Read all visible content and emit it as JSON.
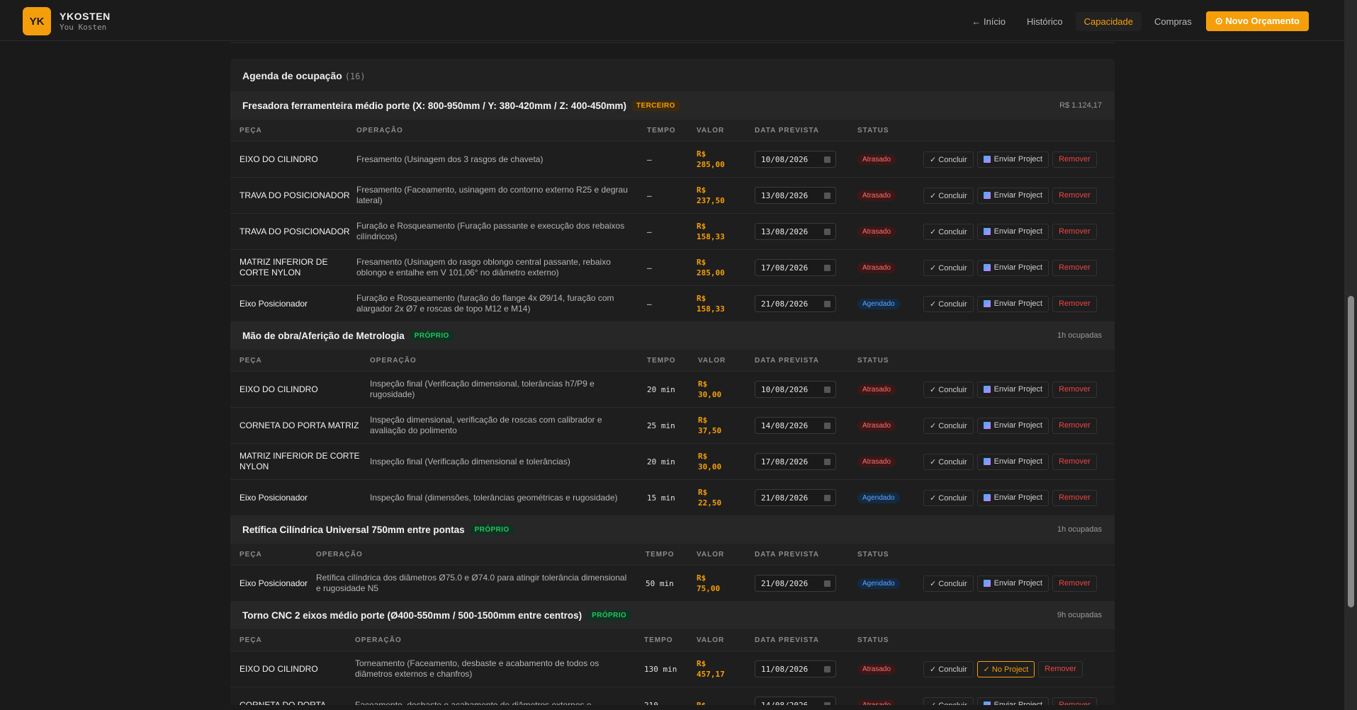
{
  "app": {
    "logo": "YK",
    "name": "YKOSTEN",
    "subtitle": "You Kosten"
  },
  "nav": {
    "items": [
      {
        "label": "← Início",
        "active": false
      },
      {
        "label": "Histórico",
        "active": false
      },
      {
        "label": "Capacidade",
        "active": true
      },
      {
        "label": "Compras",
        "active": false
      }
    ],
    "primary_button": "⊙ Novo Orçamento"
  },
  "colors": {
    "accent": "#f59e0b",
    "late": "#f87171",
    "scheduled": "#60a5fa",
    "proprio": "#22c55e"
  },
  "agenda": {
    "title": "Agenda de ocupação",
    "count": "(16)",
    "columns": {
      "peca": "PEÇA",
      "operacao": "OPERAÇÃO",
      "tempo": "TEMPO",
      "valor": "VALOR",
      "data": "DATA PREVISTA",
      "status": "STATUS"
    },
    "actions": {
      "concluir": "✓ Concluir",
      "enviar": "Enviar Project",
      "remover": "Remover",
      "no_project": "✓ No Project"
    },
    "groups": [
      {
        "name": "Fresadora ferramenteira médio porte (X: 800-950mm / Y: 380-420mm / Z: 400-450mm)",
        "type": "TERCEIRO",
        "right": "R$ 1.124,17",
        "rows": [
          {
            "peca": "EIXO DO CILINDRO",
            "operacao": "Fresamento (Usinagem dos 3 rasgos de chaveta)",
            "tempo": "—",
            "valor": "R$ 285,00",
            "data": "10/08/2026",
            "status": "Atrasado"
          },
          {
            "peca": "TRAVA DO POSICIONADOR",
            "operacao": "Fresamento (Faceamento, usinagem do contorno externo R25 e degrau lateral)",
            "tempo": "—",
            "valor": "R$ 237,50",
            "data": "13/08/2026",
            "status": "Atrasado"
          },
          {
            "peca": "TRAVA DO POSICIONADOR",
            "operacao": "Furação e Rosqueamento (Furação passante e execução dos rebaixos cilíndricos)",
            "tempo": "—",
            "valor": "R$ 158,33",
            "data": "13/08/2026",
            "status": "Atrasado"
          },
          {
            "peca": "MATRIZ INFERIOR DE CORTE NYLON",
            "operacao": "Fresamento (Usinagem do rasgo oblongo central passante, rebaixo oblongo e entalhe em V 101,06° no diâmetro externo)",
            "tempo": "—",
            "valor": "R$ 285,00",
            "data": "17/08/2026",
            "status": "Atrasado"
          },
          {
            "peca": "Eixo Posicionador",
            "operacao": "Furação e Rosqueamento (furação do flange 4x Ø9/14, furação com alargador 2x Ø7 e roscas de topo M12 e M14)",
            "tempo": "—",
            "valor": "R$ 158,33",
            "data": "21/08/2026",
            "status": "Agendado"
          }
        ]
      },
      {
        "name": "Mão de obra/Aferição de Metrologia",
        "type": "PRÓPRIO",
        "right": "1h ocupadas",
        "rows": [
          {
            "peca": "EIXO DO CILINDRO",
            "operacao": "Inspeção final (Verificação dimensional, tolerâncias h7/P9 e rugosidade)",
            "tempo": "20 min",
            "valor": "R$ 30,00",
            "data": "10/08/2026",
            "status": "Atrasado"
          },
          {
            "peca": "CORNETA DO PORTA MATRIZ",
            "operacao": "Inspeção dimensional, verificação de roscas com calibrador e avaliação do polimento",
            "tempo": "25 min",
            "valor": "R$ 37,50",
            "data": "14/08/2026",
            "status": "Atrasado"
          },
          {
            "peca": "MATRIZ INFERIOR DE CORTE NYLON",
            "operacao": "Inspeção final (Verificação dimensional e tolerâncias)",
            "tempo": "20 min",
            "valor": "R$ 30,00",
            "data": "17/08/2026",
            "status": "Atrasado"
          },
          {
            "peca": "Eixo Posicionador",
            "operacao": "Inspeção final (dimensões, tolerâncias geométricas e rugosidade)",
            "tempo": "15 min",
            "valor": "R$ 22,50",
            "data": "21/08/2026",
            "status": "Agendado"
          }
        ]
      },
      {
        "name": "Retífica Cilíndrica Universal 750mm entre pontas",
        "type": "PRÓPRIO",
        "right": "1h ocupadas",
        "rows": [
          {
            "peca": "Eixo Posicionador",
            "operacao": "Retífica cilíndrica dos diâmetros Ø75.0 e Ø74.0 para atingir tolerância dimensional e rugosidade N5",
            "tempo": "50 min",
            "valor": "R$ 75,00",
            "data": "21/08/2026",
            "status": "Agendado"
          }
        ]
      },
      {
        "name": "Torno CNC 2 eixos médio porte (Ø400-550mm / 500-1500mm entre centros)",
        "type": "PRÓPRIO",
        "right": "9h ocupadas",
        "rows": [
          {
            "peca": "EIXO DO CILINDRO",
            "operacao": "Torneamento (Faceamento, desbaste e acabamento de todos os diâmetros externos e chanfros)",
            "tempo": "130 min",
            "valor": "R$ 457,17",
            "data": "11/08/2026",
            "status": "Atrasado",
            "no_project": true
          },
          {
            "peca": "CORNETA DO PORTA",
            "operacao": "Faceamento, desbaste e acabamento de diâmetros externos e",
            "tempo": "210",
            "valor": "R$",
            "data": "14/08/2026",
            "status": "Atrasado"
          }
        ]
      }
    ]
  }
}
